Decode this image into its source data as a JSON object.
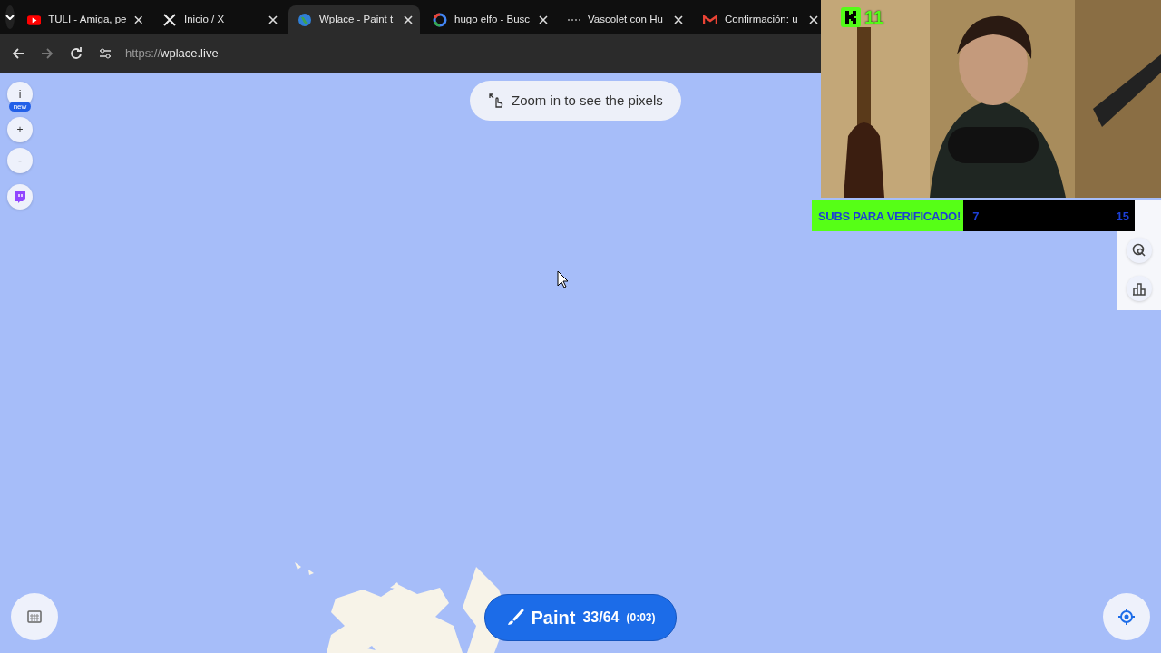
{
  "browser": {
    "tabs": [
      {
        "kind": "youtube",
        "title": "TULI - Amiga, pe",
        "selected": false
      },
      {
        "kind": "x",
        "title": "Inicio / X",
        "selected": false
      },
      {
        "kind": "globe",
        "title": "Wplace - Paint t",
        "selected": true
      },
      {
        "kind": "google",
        "title": "hugo elfo - Busc",
        "selected": false
      },
      {
        "kind": "dots",
        "title": "Vascolet con Hu",
        "selected": false
      },
      {
        "kind": "gmail",
        "title": "Confirmación: u",
        "selected": false
      }
    ],
    "url": {
      "scheme": "https://",
      "host": "wplace.live"
    }
  },
  "map": {
    "zoom_hint": "Zoom in to see the pixels",
    "left_controls": [
      {
        "kind": "info",
        "label": "i",
        "badge": "new"
      },
      {
        "kind": "text",
        "label": "+"
      },
      {
        "kind": "text",
        "label": "-"
      },
      {
        "kind": "twitch"
      }
    ],
    "paint_button": {
      "label": "Paint",
      "charges": "33/64",
      "timer": "(0:03)"
    }
  },
  "stream_overlay": {
    "viewers": "11",
    "sub_goal": {
      "label": "SUBS PARA VERIFICADO!",
      "current": "7",
      "target": "15",
      "level": 0.47
    }
  }
}
